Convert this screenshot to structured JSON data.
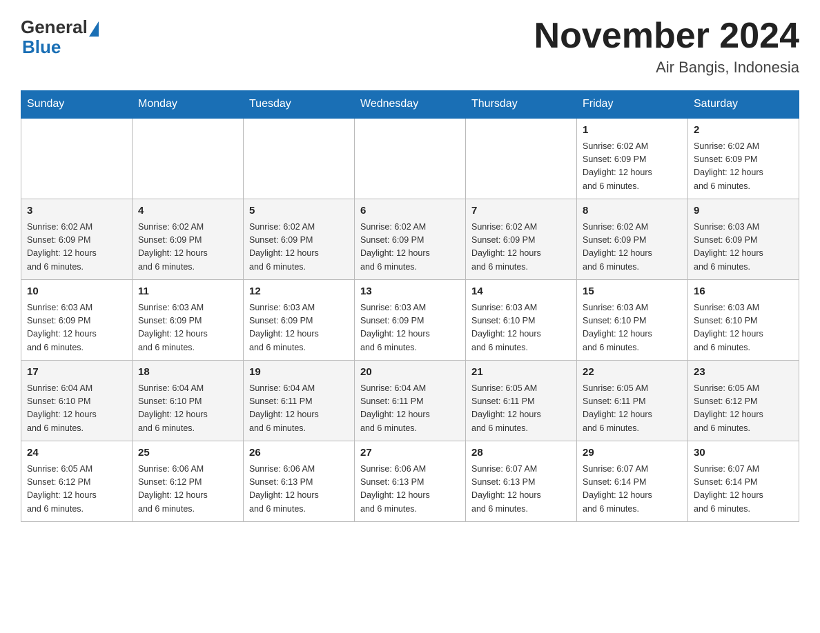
{
  "header": {
    "logo_general": "General",
    "logo_blue": "Blue",
    "month_title": "November 2024",
    "location": "Air Bangis, Indonesia"
  },
  "weekdays": [
    "Sunday",
    "Monday",
    "Tuesday",
    "Wednesday",
    "Thursday",
    "Friday",
    "Saturday"
  ],
  "weeks": [
    [
      {
        "day": "",
        "info": ""
      },
      {
        "day": "",
        "info": ""
      },
      {
        "day": "",
        "info": ""
      },
      {
        "day": "",
        "info": ""
      },
      {
        "day": "",
        "info": ""
      },
      {
        "day": "1",
        "info": "Sunrise: 6:02 AM\nSunset: 6:09 PM\nDaylight: 12 hours\nand 6 minutes."
      },
      {
        "day": "2",
        "info": "Sunrise: 6:02 AM\nSunset: 6:09 PM\nDaylight: 12 hours\nand 6 minutes."
      }
    ],
    [
      {
        "day": "3",
        "info": "Sunrise: 6:02 AM\nSunset: 6:09 PM\nDaylight: 12 hours\nand 6 minutes."
      },
      {
        "day": "4",
        "info": "Sunrise: 6:02 AM\nSunset: 6:09 PM\nDaylight: 12 hours\nand 6 minutes."
      },
      {
        "day": "5",
        "info": "Sunrise: 6:02 AM\nSunset: 6:09 PM\nDaylight: 12 hours\nand 6 minutes."
      },
      {
        "day": "6",
        "info": "Sunrise: 6:02 AM\nSunset: 6:09 PM\nDaylight: 12 hours\nand 6 minutes."
      },
      {
        "day": "7",
        "info": "Sunrise: 6:02 AM\nSunset: 6:09 PM\nDaylight: 12 hours\nand 6 minutes."
      },
      {
        "day": "8",
        "info": "Sunrise: 6:02 AM\nSunset: 6:09 PM\nDaylight: 12 hours\nand 6 minutes."
      },
      {
        "day": "9",
        "info": "Sunrise: 6:03 AM\nSunset: 6:09 PM\nDaylight: 12 hours\nand 6 minutes."
      }
    ],
    [
      {
        "day": "10",
        "info": "Sunrise: 6:03 AM\nSunset: 6:09 PM\nDaylight: 12 hours\nand 6 minutes."
      },
      {
        "day": "11",
        "info": "Sunrise: 6:03 AM\nSunset: 6:09 PM\nDaylight: 12 hours\nand 6 minutes."
      },
      {
        "day": "12",
        "info": "Sunrise: 6:03 AM\nSunset: 6:09 PM\nDaylight: 12 hours\nand 6 minutes."
      },
      {
        "day": "13",
        "info": "Sunrise: 6:03 AM\nSunset: 6:09 PM\nDaylight: 12 hours\nand 6 minutes."
      },
      {
        "day": "14",
        "info": "Sunrise: 6:03 AM\nSunset: 6:10 PM\nDaylight: 12 hours\nand 6 minutes."
      },
      {
        "day": "15",
        "info": "Sunrise: 6:03 AM\nSunset: 6:10 PM\nDaylight: 12 hours\nand 6 minutes."
      },
      {
        "day": "16",
        "info": "Sunrise: 6:03 AM\nSunset: 6:10 PM\nDaylight: 12 hours\nand 6 minutes."
      }
    ],
    [
      {
        "day": "17",
        "info": "Sunrise: 6:04 AM\nSunset: 6:10 PM\nDaylight: 12 hours\nand 6 minutes."
      },
      {
        "day": "18",
        "info": "Sunrise: 6:04 AM\nSunset: 6:10 PM\nDaylight: 12 hours\nand 6 minutes."
      },
      {
        "day": "19",
        "info": "Sunrise: 6:04 AM\nSunset: 6:11 PM\nDaylight: 12 hours\nand 6 minutes."
      },
      {
        "day": "20",
        "info": "Sunrise: 6:04 AM\nSunset: 6:11 PM\nDaylight: 12 hours\nand 6 minutes."
      },
      {
        "day": "21",
        "info": "Sunrise: 6:05 AM\nSunset: 6:11 PM\nDaylight: 12 hours\nand 6 minutes."
      },
      {
        "day": "22",
        "info": "Sunrise: 6:05 AM\nSunset: 6:11 PM\nDaylight: 12 hours\nand 6 minutes."
      },
      {
        "day": "23",
        "info": "Sunrise: 6:05 AM\nSunset: 6:12 PM\nDaylight: 12 hours\nand 6 minutes."
      }
    ],
    [
      {
        "day": "24",
        "info": "Sunrise: 6:05 AM\nSunset: 6:12 PM\nDaylight: 12 hours\nand 6 minutes."
      },
      {
        "day": "25",
        "info": "Sunrise: 6:06 AM\nSunset: 6:12 PM\nDaylight: 12 hours\nand 6 minutes."
      },
      {
        "day": "26",
        "info": "Sunrise: 6:06 AM\nSunset: 6:13 PM\nDaylight: 12 hours\nand 6 minutes."
      },
      {
        "day": "27",
        "info": "Sunrise: 6:06 AM\nSunset: 6:13 PM\nDaylight: 12 hours\nand 6 minutes."
      },
      {
        "day": "28",
        "info": "Sunrise: 6:07 AM\nSunset: 6:13 PM\nDaylight: 12 hours\nand 6 minutes."
      },
      {
        "day": "29",
        "info": "Sunrise: 6:07 AM\nSunset: 6:14 PM\nDaylight: 12 hours\nand 6 minutes."
      },
      {
        "day": "30",
        "info": "Sunrise: 6:07 AM\nSunset: 6:14 PM\nDaylight: 12 hours\nand 6 minutes."
      }
    ]
  ]
}
